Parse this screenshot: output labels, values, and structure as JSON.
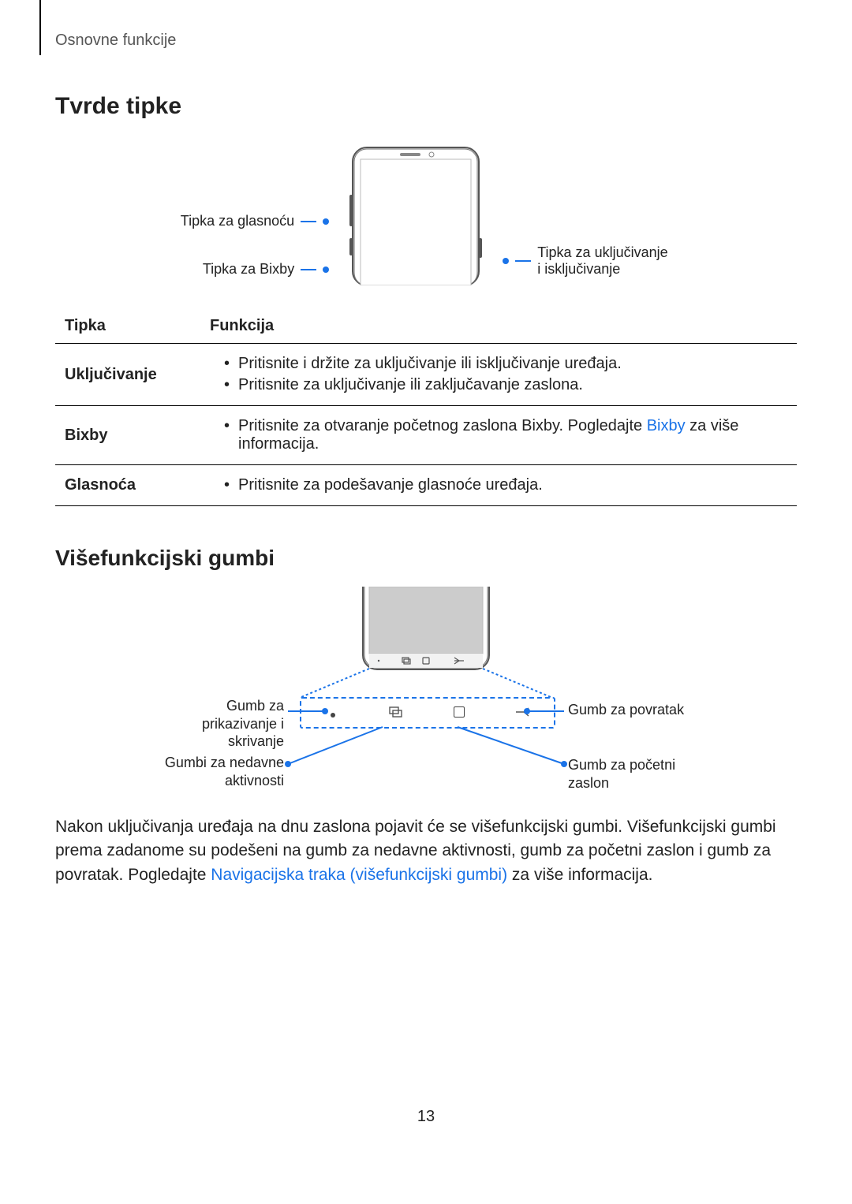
{
  "breadcrumb": "Osnovne funkcije",
  "heading1": "Tvrde tipke",
  "d1_labels": {
    "volume": "Tipka za glasnoću",
    "bixby": "Tipka za Bixby",
    "power": "Tipka za uključivanje i isključivanje"
  },
  "table": {
    "col1": "Tipka",
    "col2": "Funkcija",
    "rows": [
      {
        "key": "Uključivanje",
        "items": [
          "Pritisnite i držite za uključivanje ili isključivanje uređaja.",
          "Pritisnite za uključivanje ili zaključavanje zaslona."
        ]
      },
      {
        "key": "Bixby",
        "items_pre": "Pritisnite za otvaranje početnog zaslona Bixby. Pogledajte ",
        "link": "Bixby",
        "items_post": " za više informacija."
      },
      {
        "key": "Glasnoća",
        "items": [
          "Pritisnite za podešavanje glasnoće uređaja."
        ]
      }
    ]
  },
  "heading2": "Višefunkcijski gumbi",
  "d2_labels": {
    "show_hide": "Gumb za prikazivanje i skrivanje",
    "recents": "Gumbi za nedavne aktivnosti",
    "back": "Gumb za povratak",
    "home": "Gumb za početni zaslon"
  },
  "paragraph": {
    "pre": "Nakon uključivanja uređaja na dnu zaslona pojavit će se višefunkcijski gumbi. Višefunkcijski gumbi prema zadanome su podešeni na gumb za nedavne aktivnosti, gumb za početni zaslon i gumb za povratak. Pogledajte ",
    "link": "Navigacijska traka (višefunkcijski gumbi)",
    "post": " za više informacija."
  },
  "page_number": "13"
}
